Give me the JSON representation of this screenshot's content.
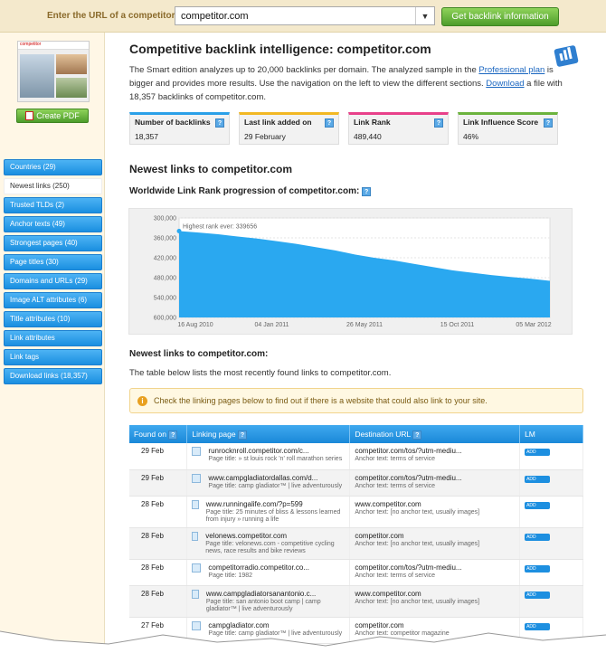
{
  "header": {
    "label": "Enter the URL of a competitor:",
    "url_value": "competitor.com",
    "submit_label": "Get backlink information"
  },
  "sidebar": {
    "pdf_label": "Create PDF",
    "thumb_text": "competitor",
    "items": [
      {
        "label": "Countries (29)",
        "active": false
      },
      {
        "label": "Newest links (250)",
        "active": true
      },
      {
        "label": "Trusted TLDs (2)",
        "active": false
      },
      {
        "label": "Anchor texts (49)",
        "active": false
      },
      {
        "label": "Strongest pages (40)",
        "active": false
      },
      {
        "label": "Page titles (30)",
        "active": false
      },
      {
        "label": "Domains and URLs (29)",
        "active": false
      },
      {
        "label": "Image ALT attributes (6)",
        "active": false
      },
      {
        "label": "Title attributes (10)",
        "active": false
      },
      {
        "label": "Link attributes",
        "active": false
      },
      {
        "label": "Link tags",
        "active": false
      },
      {
        "label": "Download links (18,357)",
        "active": false
      }
    ]
  },
  "main": {
    "title": "Competitive backlink intelligence: competitor.com",
    "intro_1": "The Smart edition analyzes up to 20,000 backlinks per domain. The analyzed sample in the ",
    "intro_link_1": "Professional plan",
    "intro_2": " is bigger and provides more results. Use the navigation on the left to view the different sections. ",
    "intro_link_2": "Download",
    "intro_3": " a file with 18,357 backlinks of competitor.com.",
    "stats": [
      {
        "title": "Number of backlinks",
        "value": "18,357",
        "color": "#2aa0e8"
      },
      {
        "title": "Last link added on",
        "value": "29 February",
        "color": "#f2b824"
      },
      {
        "title": "Link Rank",
        "value": "489,440",
        "color": "#e8418a"
      },
      {
        "title": "Link Influence Score",
        "value": "46%",
        "color": "#6cb33e"
      }
    ],
    "section_title": "Newest links to competitor.com",
    "chart_title": "Worldwide Link Rank progression of competitor.com:",
    "list_title": "Newest links to competitor.com:",
    "list_desc": "The table below lists the most recently found links to competitor.com.",
    "notice": "Check the linking pages below to find out if there is a website that could also link to your site."
  },
  "chart_data": {
    "type": "area",
    "annotation": "Highest rank ever: 339656",
    "yticks": [
      "300,000",
      "360,000",
      "420,000",
      "480,000",
      "540,000",
      "600,000"
    ],
    "xticks": [
      "16 Aug 2010",
      "04 Jan 2011",
      "26 May 2011",
      "15 Oct 2011",
      "05 Mar 2012"
    ],
    "ylim": [
      300000,
      600000
    ],
    "y_inverted": true,
    "color": "#2aa8f0",
    "series": [
      {
        "values": [
          339656,
          344000,
          349000,
          356000,
          362000,
          370000,
          378000,
          388000,
          398000,
          410000,
          420000,
          428000,
          438000,
          448000,
          458000,
          465000,
          472000,
          478000,
          483000,
          489440
        ]
      }
    ]
  },
  "table": {
    "headers": [
      "Found on",
      "Linking page",
      "Destination URL",
      "LM"
    ],
    "add_label": "ADD",
    "rows": [
      {
        "date": "29 Feb",
        "link": "runrocknroll.competitor.com/c...",
        "link_sub": "Page title: » st louis rock 'n' roll marathon series",
        "dest": "competitor.com/tos/?utm-mediu...",
        "dest_sub": "Anchor text: terms of service"
      },
      {
        "date": "29 Feb",
        "link": "www.campgladiatordallas.com/d...",
        "link_sub": "Page title: camp gladiator™ | live adventurously",
        "dest": "competitor.com/tos/?utm-mediu...",
        "dest_sub": "Anchor text: terms of service"
      },
      {
        "date": "28 Feb",
        "link": "www.runningalife.com/?p=599",
        "link_sub": "Page title: 25 minutes of bliss & lessons learned from injury » running a life",
        "dest": "www.competitor.com",
        "dest_sub": "Anchor text: [no anchor text, usually images]"
      },
      {
        "date": "28 Feb",
        "link": "velonews.competitor.com",
        "link_sub": "Page title: velonews.com - competitive cycling news, race results and bike reviews",
        "dest": "competitor.com",
        "dest_sub": "Anchor text: [no anchor text, usually images]"
      },
      {
        "date": "28 Feb",
        "link": "competitorradio.competitor.co...",
        "link_sub": "Page title: 1982",
        "dest": "competitor.com/tos/?utm-mediu...",
        "dest_sub": "Anchor text: terms of service"
      },
      {
        "date": "28 Feb",
        "link": "www.campgladiatorsanantonio.c...",
        "link_sub": "Page title: san antonio boot camp | camp gladiator™ | live adventurously",
        "dest": "www.competitor.com",
        "dest_sub": "Anchor text: [no anchor text, usually images]"
      },
      {
        "date": "27 Feb",
        "link": "campgladiator.com",
        "link_sub": "Page title: camp gladiator™ | live adventurously",
        "dest": "competitor.com",
        "dest_sub": "Anchor text: competitor magazine"
      }
    ]
  }
}
